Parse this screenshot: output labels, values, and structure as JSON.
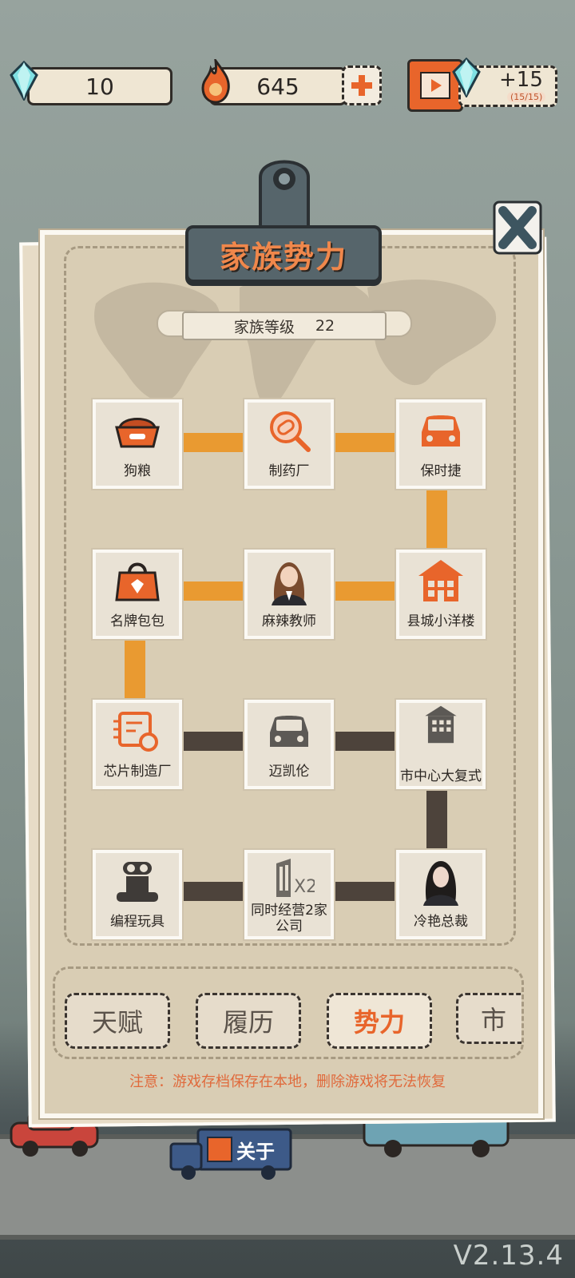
{
  "resources": {
    "gems": "10",
    "flame": "645",
    "bonus_value": "+15",
    "bonus_sub": "(15/15)"
  },
  "panel": {
    "title": "家族势力",
    "level_label": "家族等级",
    "level_value": "22"
  },
  "nodes": [
    {
      "label": "狗粮",
      "icon": "dog-food-bowl-icon",
      "lit": true
    },
    {
      "label": "制药厂",
      "icon": "pill-magnifier-icon",
      "lit": true
    },
    {
      "label": "保时捷",
      "icon": "car-icon",
      "lit": true
    },
    {
      "label": "名牌包包",
      "icon": "handbag-icon",
      "lit": true
    },
    {
      "label": "麻辣教师",
      "icon": "teacher-portrait",
      "lit": true
    },
    {
      "label": "县城小洋楼",
      "icon": "house-icon",
      "lit": true
    },
    {
      "label": "芯片制造厂",
      "icon": "chip-icon",
      "lit": true
    },
    {
      "label": "迈凯伦",
      "icon": "car-icon",
      "lit": false
    },
    {
      "label": "市中心大复式",
      "icon": "building-icon",
      "lit": false
    },
    {
      "label": "编程玩具",
      "icon": "robot-icon",
      "lit": false
    },
    {
      "label": "同时经营2家公司",
      "icon": "office-x2-icon",
      "lit": false
    },
    {
      "label": "冷艳总裁",
      "icon": "ceo-portrait",
      "lit": false
    }
  ],
  "tabs": [
    {
      "label": "天赋",
      "active": false
    },
    {
      "label": "履历",
      "active": false
    },
    {
      "label": "势力",
      "active": true
    },
    {
      "label": "市",
      "active": false
    }
  ],
  "notice": "注意：游戏存档保存在本地，删除游戏将无法恢复",
  "truck_sign": "关于",
  "version": "V2.13.4",
  "colors": {
    "accent": "#e8652b",
    "path_lit": "#e99a31",
    "path_locked": "#4d433b"
  }
}
